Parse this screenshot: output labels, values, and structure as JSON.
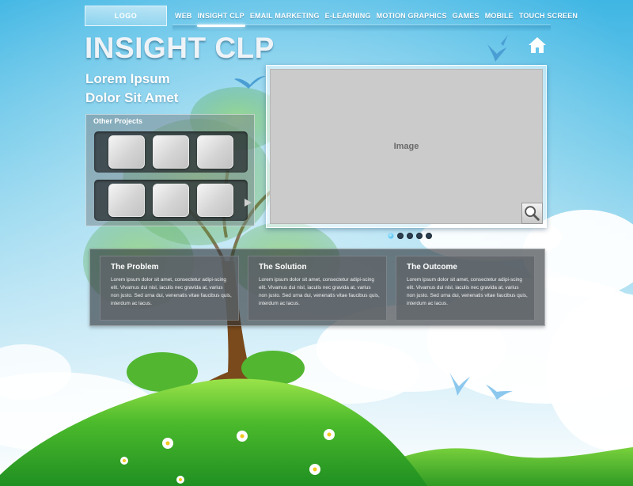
{
  "logo": {
    "text": "LOGO"
  },
  "nav": {
    "items": [
      {
        "label": "WEB",
        "active": false
      },
      {
        "label": "INSIGHT CLP",
        "active": true
      },
      {
        "label": "EMAIL MARKETING",
        "active": false
      },
      {
        "label": "E-LEARNING",
        "active": false
      },
      {
        "label": "MOTION GRAPHICS",
        "active": false
      },
      {
        "label": "GAMES",
        "active": false
      },
      {
        "label": "MOBILE",
        "active": false
      },
      {
        "label": "TOUCH SCREEN",
        "active": false
      }
    ]
  },
  "header": {
    "title": "INSIGHT CLP",
    "subtitle_line1": "Lorem Ipsum",
    "subtitle_line2": "Dolor Sit Amet",
    "home_icon": "home-icon"
  },
  "projects": {
    "title": "Other Projects",
    "thumbnail_count": 6,
    "next_icon": "arrow-right-icon"
  },
  "viewer": {
    "label": "Image",
    "zoom_icon": "magnifier-icon",
    "slides": 5,
    "active_slide": 1
  },
  "cards": [
    {
      "title": "The Problem",
      "text": "Lorem ipsum dolor sit amet, consectetur adipi-scing elit. Vivamus dui nisl, iaculis nec gravida at, varius non justo. Sed urna dui, venenatis vitae faucibus quis, interdum ac lacus."
    },
    {
      "title": "The Solution",
      "text": "Lorem ipsum dolor sit amet, consectetur adipi-scing elit. Vivamus dui nisl, iaculis nec gravida at, varius non justo. Sed urna dui, venenatis vitae faucibus quis, interdum ac lacus."
    },
    {
      "title": "The Outcome",
      "text": "Lorem ipsum dolor sit amet, consectetur adipi-scing elit. Vivamus dui nisl, iaculis nec gravida at, varius non justo. Sed urna dui, venenatis vitae faucibus quis, interdum ac lacus."
    }
  ],
  "colors": {
    "sky_top": "#3fb6e4",
    "hill_green": "#3fae2a",
    "tree_trunk": "#7a4a1c",
    "panel_dark": "#2d3237"
  }
}
